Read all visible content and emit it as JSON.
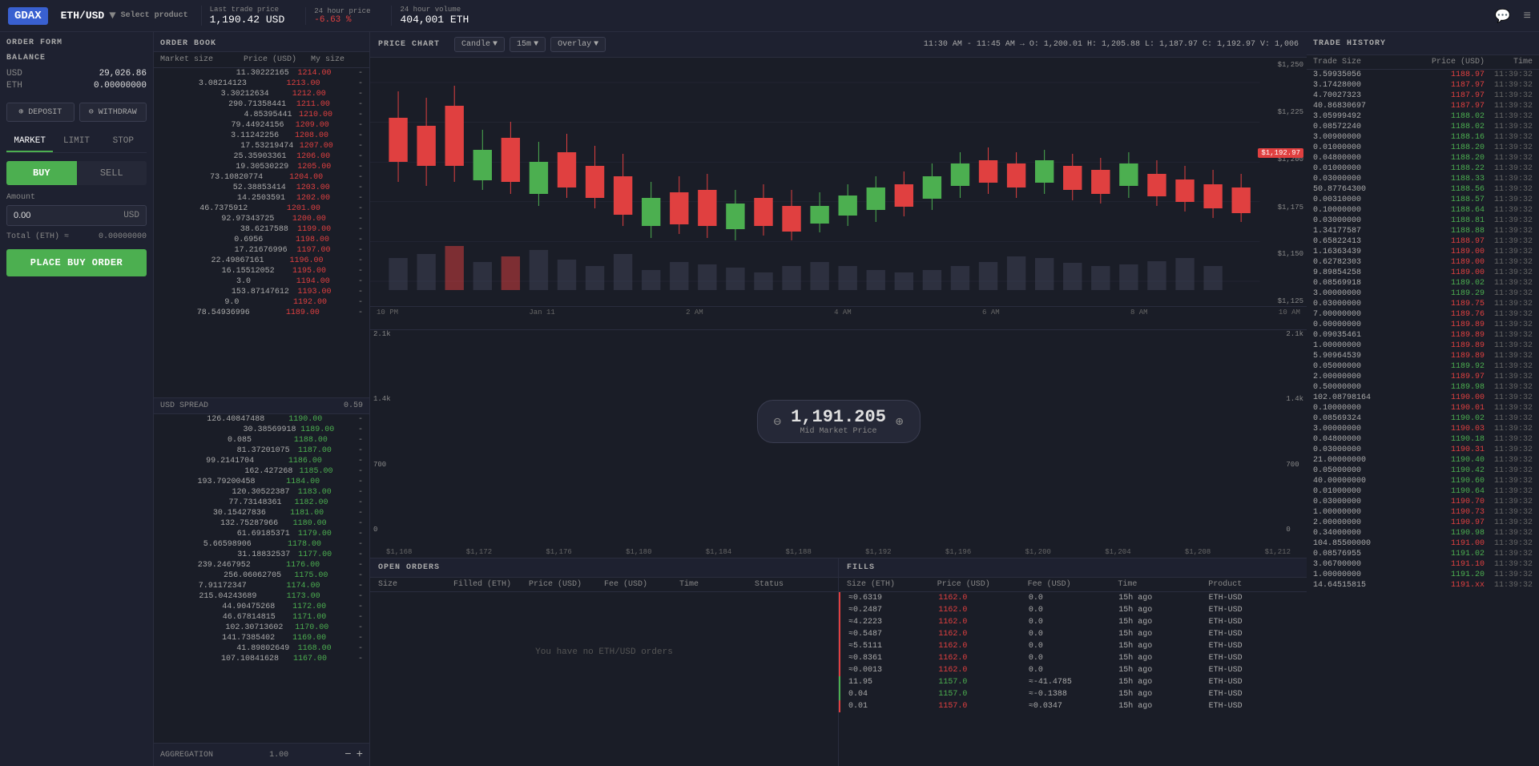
{
  "nav": {
    "logo": "GDAX",
    "pair": "ETH/USD",
    "pair_sub": "Select product",
    "last_price_label": "Last trade price",
    "last_price": "1,190.42 USD",
    "change_label": "24 hour price",
    "change": "-6.63 %",
    "volume_label": "24 hour volume",
    "volume": "404,001 ETH",
    "chat_icon": "💬",
    "menu_icon": "≡"
  },
  "order_form": {
    "title": "ORDER FORM",
    "balance_title": "BALANCE",
    "balance_usd_label": "USD",
    "balance_usd_amount": "29,026.86",
    "balance_eth_label": "ETH",
    "balance_eth_amount": "0.00000000",
    "deposit_label": "⊕ DEPOSIT",
    "withdraw_label": "⊖ WITHDRAW",
    "tabs": [
      "MARKET",
      "LIMIT",
      "STOP"
    ],
    "active_tab": "MARKET",
    "buy_label": "BUY",
    "sell_label": "SELL",
    "amount_label": "Amount",
    "amount_value": "0.00",
    "amount_suffix": "USD",
    "total_label": "Total (ETH) ≈",
    "total_value": "0.00000000",
    "place_buy_label": "PLACE BUY ORDER"
  },
  "order_book": {
    "title": "ORDER BOOK",
    "col_market": "Market size",
    "col_price": "Price (USD)",
    "col_mysize": "My size",
    "asks": [
      {
        "size": "11.30222165",
        "price": "1214.00"
      },
      {
        "size": "3.08214123",
        "price": "1213.00"
      },
      {
        "size": "3.30212634",
        "price": "1212.00"
      },
      {
        "size": "290.71358441",
        "price": "1211.00"
      },
      {
        "size": "4.85395441",
        "price": "1210.00"
      },
      {
        "size": "79.44924156",
        "price": "1209.00"
      },
      {
        "size": "3.11242256",
        "price": "1208.00"
      },
      {
        "size": "17.53219474",
        "price": "1207.00"
      },
      {
        "size": "25.35903361",
        "price": "1206.00"
      },
      {
        "size": "19.30530229",
        "price": "1205.00"
      },
      {
        "size": "73.10820774",
        "price": "1204.00"
      },
      {
        "size": "52.38853414",
        "price": "1203.00"
      },
      {
        "size": "14.2503591",
        "price": "1202.00"
      },
      {
        "size": "46.7375912",
        "price": "1201.00"
      },
      {
        "size": "92.97343725",
        "price": "1200.00"
      },
      {
        "size": "38.6217588",
        "price": "1199.00"
      },
      {
        "size": "0.6956",
        "price": "1198.00"
      },
      {
        "size": "17.21676996",
        "price": "1197.00"
      },
      {
        "size": "22.49867161",
        "price": "1196.00"
      },
      {
        "size": "16.15512052",
        "price": "1195.00"
      },
      {
        "size": "3.0",
        "price": "1194.00"
      },
      {
        "size": "153.87147612",
        "price": "1193.00"
      },
      {
        "size": "9.0",
        "price": "1192.00"
      },
      {
        "size": "78.54936996",
        "price": "1189.00"
      }
    ],
    "spread_label": "USD SPREAD",
    "spread_value": "0.59",
    "bids": [
      {
        "size": "126.40847488",
        "price": "1190.00"
      },
      {
        "size": "30.38569918",
        "price": "1189.00"
      },
      {
        "size": "0.085",
        "price": "1188.00"
      },
      {
        "size": "81.37201075",
        "price": "1187.00"
      },
      {
        "size": "99.2141704",
        "price": "1186.00"
      },
      {
        "size": "162.427268",
        "price": "1185.00"
      },
      {
        "size": "193.79200458",
        "price": "1184.00"
      },
      {
        "size": "120.30522387",
        "price": "1183.00"
      },
      {
        "size": "77.73148361",
        "price": "1182.00"
      },
      {
        "size": "30.15427836",
        "price": "1181.00"
      },
      {
        "size": "132.75287966",
        "price": "1180.00"
      },
      {
        "size": "61.69185371",
        "price": "1179.00"
      },
      {
        "size": "5.66598906",
        "price": "1178.00"
      },
      {
        "size": "31.18832537",
        "price": "1177.00"
      },
      {
        "size": "239.2467952",
        "price": "1176.00"
      },
      {
        "size": "256.06062705",
        "price": "1175.00"
      },
      {
        "size": "7.91172347",
        "price": "1174.00"
      },
      {
        "size": "215.04243689",
        "price": "1173.00"
      },
      {
        "size": "44.90475268",
        "price": "1172.00"
      },
      {
        "size": "46.67814815",
        "price": "1171.00"
      },
      {
        "size": "102.30713602",
        "price": "1170.00"
      },
      {
        "size": "141.7385402",
        "price": "1169.00"
      },
      {
        "size": "41.89802649",
        "price": "1168.00"
      },
      {
        "size": "107.10841628",
        "price": "1167.00"
      }
    ],
    "aggregation_label": "AGGREGATION",
    "aggregation_value": "1.00"
  },
  "price_chart": {
    "title": "PRICE CHART",
    "chart_type": "Candle",
    "timeframe": "15m",
    "overlay": "Overlay",
    "info": {
      "time_range": "11:30 AM - 11:45 AM →",
      "open": "O: 1,200.01",
      "high": "H: 1,205.88",
      "low": "L: 1,187.97",
      "close": "C: 1,192.97",
      "volume": "V: 1,006"
    },
    "price_labels": [
      "$1,250",
      "$1,225",
      "$1,200",
      "$1,175",
      "$1,150",
      "$1,125"
    ],
    "current_price": "$1,192.97",
    "x_labels": [
      "10 PM",
      "Jan 11",
      "2 AM",
      "4 AM",
      "6 AM",
      "8 AM",
      "10 AM"
    ],
    "depth_labels_left": [
      "2.1k",
      "1.4k",
      "700",
      "0"
    ],
    "depth_labels_right": [
      "2.1k",
      "1.4k",
      "700",
      "0"
    ],
    "depth_x_labels": [
      "$1,168",
      "$1,172",
      "$1,176",
      "$1,180",
      "$1,184",
      "$1,188",
      "$1,192",
      "$1,196",
      "$1,200",
      "$1,204",
      "$1,208",
      "$1,212"
    ],
    "mid_price": "1,191.205",
    "mid_price_label": "Mid Market Price"
  },
  "open_orders": {
    "title": "OPEN ORDERS",
    "cols": [
      "Size",
      "Filled (ETH)",
      "Price (USD)",
      "Fee (USD)",
      "Time",
      "Status"
    ],
    "empty_msg": "You have no ETH/USD orders"
  },
  "fills": {
    "title": "FILLS",
    "cols": [
      "Size (ETH)",
      "Price (USD)",
      "Fee (USD)",
      "Time",
      "Product"
    ],
    "rows": [
      {
        "size": "≈0.6319",
        "price": "1162.0",
        "fee": "0.0",
        "time": "15h ago",
        "product": "ETH-USD",
        "side": "sell"
      },
      {
        "size": "≈0.2487",
        "price": "1162.0",
        "fee": "0.0",
        "time": "15h ago",
        "product": "ETH-USD",
        "side": "sell"
      },
      {
        "size": "≈4.2223",
        "price": "1162.0",
        "fee": "0.0",
        "time": "15h ago",
        "product": "ETH-USD",
        "side": "sell"
      },
      {
        "size": "≈0.5487",
        "price": "1162.0",
        "fee": "0.0",
        "time": "15h ago",
        "product": "ETH-USD",
        "side": "sell"
      },
      {
        "size": "≈5.5111",
        "price": "1162.0",
        "fee": "0.0",
        "time": "15h ago",
        "product": "ETH-USD",
        "side": "sell"
      },
      {
        "size": "≈0.8361",
        "price": "1162.0",
        "fee": "0.0",
        "time": "15h ago",
        "product": "ETH-USD",
        "side": "sell"
      },
      {
        "size": "≈0.0013",
        "price": "1162.0",
        "fee": "0.0",
        "time": "15h ago",
        "product": "ETH-USD",
        "side": "sell"
      },
      {
        "size": "11.95",
        "price": "1157.0",
        "fee": "≈-41.4785",
        "time": "15h ago",
        "product": "ETH-USD",
        "side": "buy"
      },
      {
        "size": "0.04",
        "price": "1157.0",
        "fee": "≈-0.1388",
        "time": "15h ago",
        "product": "ETH-USD",
        "side": "buy"
      },
      {
        "size": "0.01",
        "price": "1157.0",
        "fee": "≈0.0347",
        "time": "15h ago",
        "product": "ETH-USD",
        "side": "sell"
      }
    ]
  },
  "trade_history": {
    "title": "TRADE HISTORY",
    "col_size": "Trade Size",
    "col_price": "Price (USD)",
    "col_time": "Time",
    "rows": [
      {
        "size": "3.59935056",
        "price": "1188.97",
        "time": "11:39:32",
        "side": "sell"
      },
      {
        "size": "3.17428000",
        "price": "1187.97",
        "time": "11:39:32",
        "side": "sell"
      },
      {
        "size": "4.70027323",
        "price": "1187.97",
        "time": "11:39:32",
        "side": "sell"
      },
      {
        "size": "40.86830697",
        "price": "1187.97",
        "time": "11:39:32",
        "side": "sell"
      },
      {
        "size": "3.05999492",
        "price": "1188.02",
        "time": "11:39:32",
        "side": "buy"
      },
      {
        "size": "0.08572240",
        "price": "1188.02",
        "time": "11:39:32",
        "side": "buy"
      },
      {
        "size": "3.00900000",
        "price": "1188.16",
        "time": "11:39:32",
        "side": "buy"
      },
      {
        "size": "0.01000000",
        "price": "1188.20",
        "time": "11:39:32",
        "side": "buy"
      },
      {
        "size": "0.04800000",
        "price": "1188.20",
        "time": "11:39:32",
        "side": "buy"
      },
      {
        "size": "0.01000000",
        "price": "1188.22",
        "time": "11:39:32",
        "side": "buy"
      },
      {
        "size": "0.03000000",
        "price": "1188.33",
        "time": "11:39:32",
        "side": "buy"
      },
      {
        "size": "50.87764300",
        "price": "1188.56",
        "time": "11:39:32",
        "side": "buy"
      },
      {
        "size": "0.00310000",
        "price": "1188.57",
        "time": "11:39:32",
        "side": "buy"
      },
      {
        "size": "0.10000000",
        "price": "1188.64",
        "time": "11:39:32",
        "side": "buy"
      },
      {
        "size": "0.03000000",
        "price": "1188.81",
        "time": "11:39:32",
        "side": "buy"
      },
      {
        "size": "1.34177587",
        "price": "1188.88",
        "time": "11:39:32",
        "side": "buy"
      },
      {
        "size": "0.65822413",
        "price": "1188.97",
        "time": "11:39:32",
        "side": "sell"
      },
      {
        "size": "1.16363439",
        "price": "1189.00",
        "time": "11:39:32",
        "side": "sell"
      },
      {
        "size": "0.62782303",
        "price": "1189.00",
        "time": "11:39:32",
        "side": "sell"
      },
      {
        "size": "9.89854258",
        "price": "1189.00",
        "time": "11:39:32",
        "side": "sell"
      },
      {
        "size": "0.08569918",
        "price": "1189.02",
        "time": "11:39:32",
        "side": "buy"
      },
      {
        "size": "3.00000000",
        "price": "1189.29",
        "time": "11:39:32",
        "side": "buy"
      },
      {
        "size": "0.03000000",
        "price": "1189.75",
        "time": "11:39:32",
        "side": "sell"
      },
      {
        "size": "7.00000000",
        "price": "1189.76",
        "time": "11:39:32",
        "side": "sell"
      },
      {
        "size": "0.00000000",
        "price": "1189.89",
        "time": "11:39:32",
        "side": "sell"
      },
      {
        "size": "0.09035461",
        "price": "1189.89",
        "time": "11:39:32",
        "side": "sell"
      },
      {
        "size": "1.00000000",
        "price": "1189.89",
        "time": "11:39:32",
        "side": "sell"
      },
      {
        "size": "5.90964539",
        "price": "1189.89",
        "time": "11:39:32",
        "side": "sell"
      },
      {
        "size": "0.05000000",
        "price": "1189.92",
        "time": "11:39:32",
        "side": "buy"
      },
      {
        "size": "2.00000000",
        "price": "1189.97",
        "time": "11:39:32",
        "side": "sell"
      },
      {
        "size": "0.50000000",
        "price": "1189.98",
        "time": "11:39:32",
        "side": "buy"
      },
      {
        "size": "102.08798164",
        "price": "1190.00",
        "time": "11:39:32",
        "side": "sell"
      },
      {
        "size": "0.10000000",
        "price": "1190.01",
        "time": "11:39:32",
        "side": "sell"
      },
      {
        "size": "0.08569324",
        "price": "1190.02",
        "time": "11:39:32",
        "side": "buy"
      },
      {
        "size": "3.00000000",
        "price": "1190.03",
        "time": "11:39:32",
        "side": "sell"
      },
      {
        "size": "0.04800000",
        "price": "1190.18",
        "time": "11:39:32",
        "side": "buy"
      },
      {
        "size": "0.03000000",
        "price": "1190.31",
        "time": "11:39:32",
        "side": "sell"
      },
      {
        "size": "21.00000000",
        "price": "1190.40",
        "time": "11:39:32",
        "side": "buy"
      },
      {
        "size": "0.05000000",
        "price": "1190.42",
        "time": "11:39:32",
        "side": "buy"
      },
      {
        "size": "40.00000000",
        "price": "1190.60",
        "time": "11:39:32",
        "side": "buy"
      },
      {
        "size": "0.01000000",
        "price": "1190.64",
        "time": "11:39:32",
        "side": "buy"
      },
      {
        "size": "0.03000000",
        "price": "1190.70",
        "time": "11:39:32",
        "side": "sell"
      },
      {
        "size": "1.00000000",
        "price": "1190.73",
        "time": "11:39:32",
        "side": "sell"
      },
      {
        "size": "2.00000000",
        "price": "1190.97",
        "time": "11:39:32",
        "side": "sell"
      },
      {
        "size": "0.34000000",
        "price": "1190.98",
        "time": "11:39:32",
        "side": "buy"
      },
      {
        "size": "104.85500000",
        "price": "1191.00",
        "time": "11:39:32",
        "side": "sell"
      },
      {
        "size": "0.08576955",
        "price": "1191.02",
        "time": "11:39:32",
        "side": "buy"
      },
      {
        "size": "3.06700000",
        "price": "1191.10",
        "time": "11:39:32",
        "side": "sell"
      },
      {
        "size": "1.00000000",
        "price": "1191.20",
        "time": "11:39:32",
        "side": "buy"
      },
      {
        "size": "14.64515815",
        "price": "1191.xx",
        "time": "11:39:32",
        "side": "sell"
      }
    ]
  }
}
